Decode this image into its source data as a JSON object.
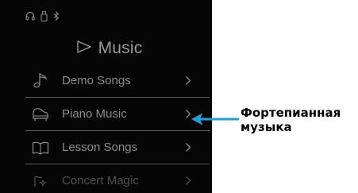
{
  "status_bar": {
    "icons": [
      "headphones-icon",
      "usb-drive-icon",
      "bluetooth-icon"
    ],
    "icon_color": "#8a8a8a"
  },
  "header": {
    "icon": "play-triangle-icon",
    "title": "Music"
  },
  "menu": {
    "items": [
      {
        "label": "Demo Songs",
        "icon": "music-note-icon",
        "state": "normal"
      },
      {
        "label": "Piano Music",
        "icon": "grand-piano-icon",
        "state": "highlighted"
      },
      {
        "label": "Lesson Songs",
        "icon": "open-book-icon",
        "state": "normal"
      },
      {
        "label": "Concert Magic",
        "icon": "magic-icon",
        "state": "partially-visible"
      }
    ],
    "chevron": "chevron-right-icon"
  },
  "callout": {
    "line1": "Фортепианная",
    "line2": "музыка",
    "arrow_color": "#1aa3dc"
  },
  "colors": {
    "screen_background": "#050505",
    "text": "#8c8c8c",
    "divider": "#5a5a5a",
    "callout_text": "#000000"
  }
}
